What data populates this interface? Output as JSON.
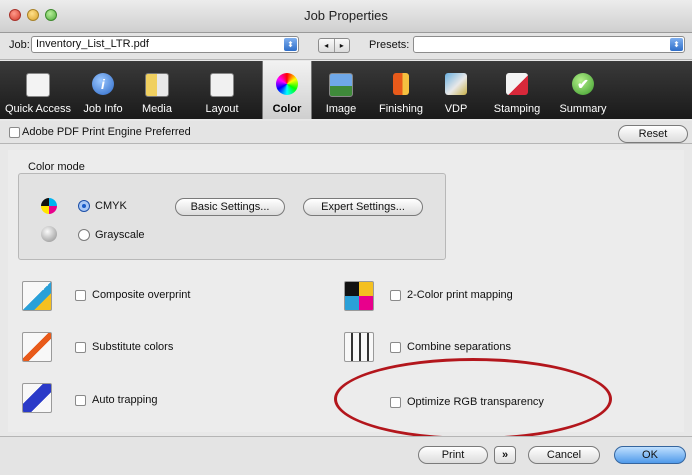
{
  "window": {
    "title": "Job Properties"
  },
  "jobbar": {
    "job_label": "Job:",
    "job_value": "Inventory_List_LTR.pdf",
    "presets_label": "Presets:",
    "presets_value": "",
    "nav_prev": "◂",
    "nav_next": "▸"
  },
  "toolbar": {
    "tabs": [
      {
        "label": "Quick Access",
        "icon": "quick-access-icon"
      },
      {
        "label": "Job Info",
        "icon": "info-icon"
      },
      {
        "label": "Media",
        "icon": "media-icon"
      },
      {
        "label": "Layout",
        "icon": "layout-icon"
      },
      {
        "label": "Color",
        "icon": "color-wheel-icon",
        "active": true
      },
      {
        "label": "Image",
        "icon": "image-icon"
      },
      {
        "label": "Finishing",
        "icon": "finishing-icon"
      },
      {
        "label": "VDP",
        "icon": "vdp-icon"
      },
      {
        "label": "Stamping",
        "icon": "stamping-icon"
      },
      {
        "label": "Summary",
        "icon": "summary-check-icon"
      }
    ]
  },
  "adobe": {
    "label": "Adobe PDF Print Engine Preferred",
    "reset_label": "Reset"
  },
  "color_mode": {
    "title": "Color mode",
    "cmyk_label": "CMYK",
    "grayscale_label": "Grayscale",
    "selected": "CMYK",
    "basic_settings_label": "Basic Settings...",
    "expert_settings_label": "Expert Settings..."
  },
  "options": {
    "composite_overprint": "Composite overprint",
    "substitute_colors": "Substitute colors",
    "auto_trapping": "Auto trapping",
    "two_color_mapping": "2-Color print mapping",
    "combine_separations": "Combine separations",
    "optimize_rgb": "Optimize RGB transparency"
  },
  "footer": {
    "print_label": "Print",
    "menu_glyph": "»",
    "cancel_label": "Cancel",
    "ok_label": "OK"
  },
  "colors": {
    "annotation_red": "#b3161c",
    "accent_blue": "#4f9aea"
  }
}
